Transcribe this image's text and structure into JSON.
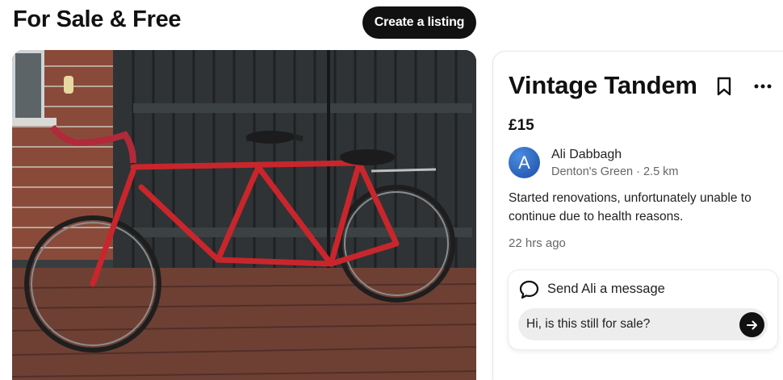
{
  "header": {
    "page_title": "For Sale & Free",
    "create_listing_label": "Create a listing"
  },
  "listing": {
    "title": "Vintage Tandem",
    "price": "£15",
    "seller": {
      "avatar_letter": "A",
      "name": "Ali Dabbagh",
      "location": "Denton's Green · 2.5 km"
    },
    "description": "Started renovations, unfortunately unable to continue due to health reasons.",
    "posted": "22 hrs ago",
    "icons": [
      "bookmark-icon",
      "more-icon"
    ]
  },
  "message": {
    "title": "Send Ali a message",
    "input_value": "Hi, is this still for sale?",
    "icons": [
      "chat-bubble-icon",
      "send-arrow-icon"
    ]
  },
  "colors": {
    "button_bg": "#111111",
    "avatar": "#2f6cc7",
    "bike_frame": "#c8262c"
  }
}
